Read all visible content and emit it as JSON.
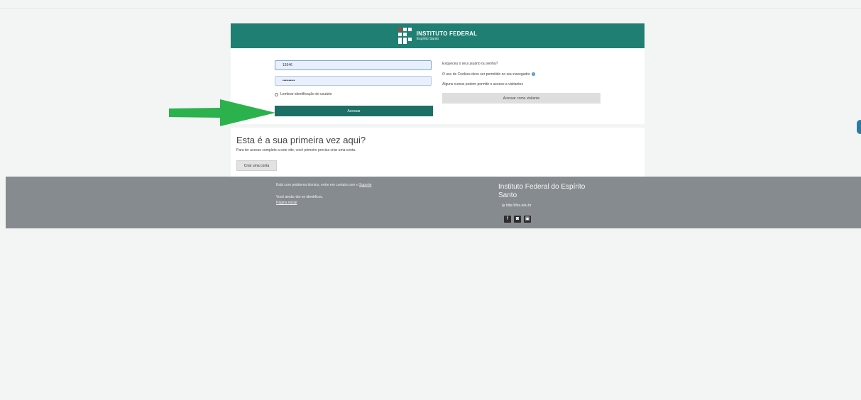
{
  "header": {
    "logo_title": "INSTITUTO FEDERAL",
    "logo_subtitle": "Espírito Santo"
  },
  "login": {
    "username_value": "19346",
    "password_value": "••••••••••",
    "remember_label": "Lembrar identificação de usuário",
    "submit_label": "Acessar"
  },
  "side": {
    "forgot_link": "Esqueceu o seu usuário ou senha?",
    "cookies_notice": "O uso de Cookies deve ser permitido no seu navegador",
    "guest_notice": "Alguns cursos podem permitir o acesso a visitantes",
    "guest_button": "Acessar como visitante"
  },
  "first_time": {
    "title": "Esta é a sua primeira vez aqui?",
    "text": "Para ter acesso completo a este site, você primeiro precisa criar uma conta.",
    "create_button": "Criar uma conta"
  },
  "footer": {
    "support_text": "Está com problema técnico, entre em contato com o",
    "support_link": "Suporte",
    "not_identified": "Você ainda não se identificou.",
    "home_link": "Página inicial",
    "institution": "Instituto Federal do Espírito Santo",
    "url": "http://ifes.edu.br"
  },
  "colors": {
    "header_bg": "#1f7f73",
    "login_button": "#1d6f66",
    "footer_bg": "#868b8f",
    "arrow": "#2bb24c"
  },
  "icons": {
    "help": "question-circle-icon",
    "globe": "globe-icon",
    "social": [
      "facebook-icon",
      "instagram-icon",
      "camera-icon"
    ]
  }
}
